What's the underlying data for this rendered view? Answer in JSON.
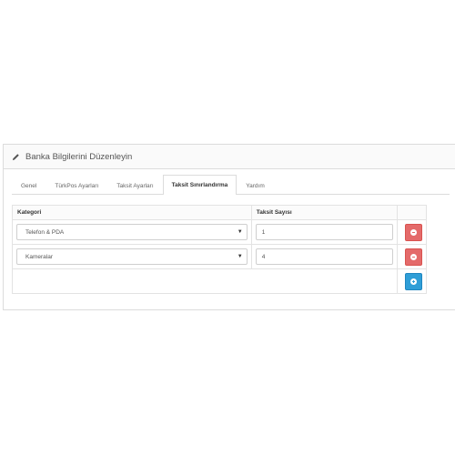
{
  "panel": {
    "title": "Banka Bilgilerini Düzenleyin",
    "icon": "pencil-icon"
  },
  "tabs": [
    {
      "label": "Genel",
      "active": false
    },
    {
      "label": "TürkPos Ayarları",
      "active": false
    },
    {
      "label": "Taksit Ayarları",
      "active": false
    },
    {
      "label": "Taksit Sınırlandırma",
      "active": true
    },
    {
      "label": "Yardım",
      "active": false
    }
  ],
  "table": {
    "headers": {
      "category": "Kategori",
      "installments": "Taksit Sayısı"
    },
    "rows": [
      {
        "category": "Telefon & PDA",
        "installments": "1"
      },
      {
        "category": "Kameralar",
        "installments": "4"
      }
    ]
  },
  "colors": {
    "remove_button": "#e46a6a",
    "add_button": "#2f9ed7"
  }
}
